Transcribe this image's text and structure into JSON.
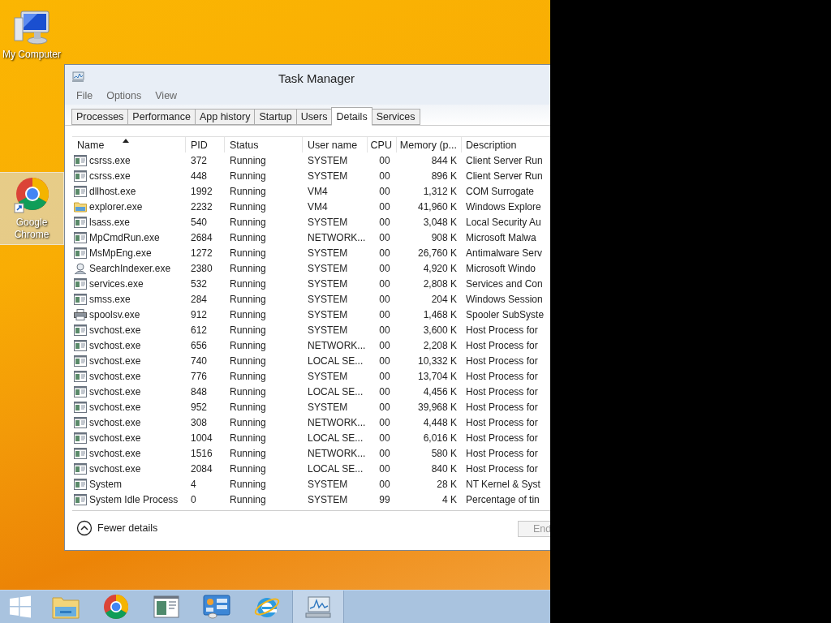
{
  "desktop": {
    "icons": [
      {
        "label": "My Computer",
        "kind": "computer",
        "selected": false
      },
      {
        "label": "Google Chrome",
        "kind": "chrome",
        "selected": true
      }
    ]
  },
  "window": {
    "title": "Task Manager",
    "menu": [
      "File",
      "Options",
      "View"
    ],
    "tabs": [
      {
        "label": "Processes",
        "selected": false
      },
      {
        "label": "Performance",
        "selected": false
      },
      {
        "label": "App history",
        "selected": false
      },
      {
        "label": "Startup",
        "selected": false
      },
      {
        "label": "Users",
        "selected": false
      },
      {
        "label": "Details",
        "selected": true
      },
      {
        "label": "Services",
        "selected": false
      }
    ],
    "table": {
      "columns": [
        "Name",
        "PID",
        "Status",
        "User name",
        "CPU",
        "Memory (p...",
        "Description"
      ],
      "rows": [
        {
          "kind": "app",
          "name": "csrss.exe",
          "pid": "372",
          "status": "Running",
          "user": "SYSTEM",
          "cpu": "00",
          "memory": "844 K",
          "description": "Client Server Run"
        },
        {
          "kind": "app",
          "name": "csrss.exe",
          "pid": "448",
          "status": "Running",
          "user": "SYSTEM",
          "cpu": "00",
          "memory": "896 K",
          "description": "Client Server Run"
        },
        {
          "kind": "app",
          "name": "dllhost.exe",
          "pid": "1992",
          "status": "Running",
          "user": "VM4",
          "cpu": "00",
          "memory": "1,312 K",
          "description": "COM Surrogate"
        },
        {
          "kind": "folder",
          "name": "explorer.exe",
          "pid": "2232",
          "status": "Running",
          "user": "VM4",
          "cpu": "00",
          "memory": "41,960 K",
          "description": "Windows Explore"
        },
        {
          "kind": "app",
          "name": "lsass.exe",
          "pid": "540",
          "status": "Running",
          "user": "SYSTEM",
          "cpu": "00",
          "memory": "3,048 K",
          "description": "Local Security Au"
        },
        {
          "kind": "app",
          "name": "MpCmdRun.exe",
          "pid": "2684",
          "status": "Running",
          "user": "NETWORK...",
          "cpu": "00",
          "memory": "908 K",
          "description": "Microsoft Malwa"
        },
        {
          "kind": "app",
          "name": "MsMpEng.exe",
          "pid": "1272",
          "status": "Running",
          "user": "SYSTEM",
          "cpu": "00",
          "memory": "26,760 K",
          "description": "Antimalware Serv"
        },
        {
          "kind": "user",
          "name": "SearchIndexer.exe",
          "pid": "2380",
          "status": "Running",
          "user": "SYSTEM",
          "cpu": "00",
          "memory": "4,920 K",
          "description": "Microsoft Windo"
        },
        {
          "kind": "app",
          "name": "services.exe",
          "pid": "532",
          "status": "Running",
          "user": "SYSTEM",
          "cpu": "00",
          "memory": "2,808 K",
          "description": "Services and Con"
        },
        {
          "kind": "app",
          "name": "smss.exe",
          "pid": "284",
          "status": "Running",
          "user": "SYSTEM",
          "cpu": "00",
          "memory": "204 K",
          "description": "Windows Session"
        },
        {
          "kind": "printer",
          "name": "spoolsv.exe",
          "pid": "912",
          "status": "Running",
          "user": "SYSTEM",
          "cpu": "00",
          "memory": "1,468 K",
          "description": "Spooler SubSyste"
        },
        {
          "kind": "app",
          "name": "svchost.exe",
          "pid": "612",
          "status": "Running",
          "user": "SYSTEM",
          "cpu": "00",
          "memory": "3,600 K",
          "description": "Host Process for"
        },
        {
          "kind": "app",
          "name": "svchost.exe",
          "pid": "656",
          "status": "Running",
          "user": "NETWORK...",
          "cpu": "00",
          "memory": "2,208 K",
          "description": "Host Process for"
        },
        {
          "kind": "app",
          "name": "svchost.exe",
          "pid": "740",
          "status": "Running",
          "user": "LOCAL SE...",
          "cpu": "00",
          "memory": "10,332 K",
          "description": "Host Process for"
        },
        {
          "kind": "app",
          "name": "svchost.exe",
          "pid": "776",
          "status": "Running",
          "user": "SYSTEM",
          "cpu": "00",
          "memory": "13,704 K",
          "description": "Host Process for"
        },
        {
          "kind": "app",
          "name": "svchost.exe",
          "pid": "848",
          "status": "Running",
          "user": "LOCAL SE...",
          "cpu": "00",
          "memory": "4,456 K",
          "description": "Host Process for"
        },
        {
          "kind": "app",
          "name": "svchost.exe",
          "pid": "952",
          "status": "Running",
          "user": "SYSTEM",
          "cpu": "00",
          "memory": "39,968 K",
          "description": "Host Process for"
        },
        {
          "kind": "app",
          "name": "svchost.exe",
          "pid": "308",
          "status": "Running",
          "user": "NETWORK...",
          "cpu": "00",
          "memory": "4,448 K",
          "description": "Host Process for"
        },
        {
          "kind": "app",
          "name": "svchost.exe",
          "pid": "1004",
          "status": "Running",
          "user": "LOCAL SE...",
          "cpu": "00",
          "memory": "6,016 K",
          "description": "Host Process for"
        },
        {
          "kind": "app",
          "name": "svchost.exe",
          "pid": "1516",
          "status": "Running",
          "user": "NETWORK...",
          "cpu": "00",
          "memory": "580 K",
          "description": "Host Process for"
        },
        {
          "kind": "app",
          "name": "svchost.exe",
          "pid": "2084",
          "status": "Running",
          "user": "LOCAL SE...",
          "cpu": "00",
          "memory": "840 K",
          "description": "Host Process for"
        },
        {
          "kind": "app",
          "name": "System",
          "pid": "4",
          "status": "Running",
          "user": "SYSTEM",
          "cpu": "00",
          "memory": "28 K",
          "description": "NT Kernel & Syst"
        },
        {
          "kind": "app",
          "name": "System Idle Process",
          "pid": "0",
          "status": "Running",
          "user": "SYSTEM",
          "cpu": "99",
          "memory": "4 K",
          "description": "Percentage of tin"
        }
      ]
    },
    "footer": {
      "toggle": "Fewer details",
      "button": "End"
    }
  },
  "taskbar": {
    "items": [
      {
        "kind": "start",
        "active": false
      },
      {
        "kind": "folder",
        "active": false
      },
      {
        "kind": "chrome",
        "active": false
      },
      {
        "kind": "window",
        "active": false
      },
      {
        "kind": "panel",
        "active": false
      },
      {
        "kind": "ie",
        "active": false
      },
      {
        "kind": "monitor",
        "active": true
      }
    ]
  }
}
